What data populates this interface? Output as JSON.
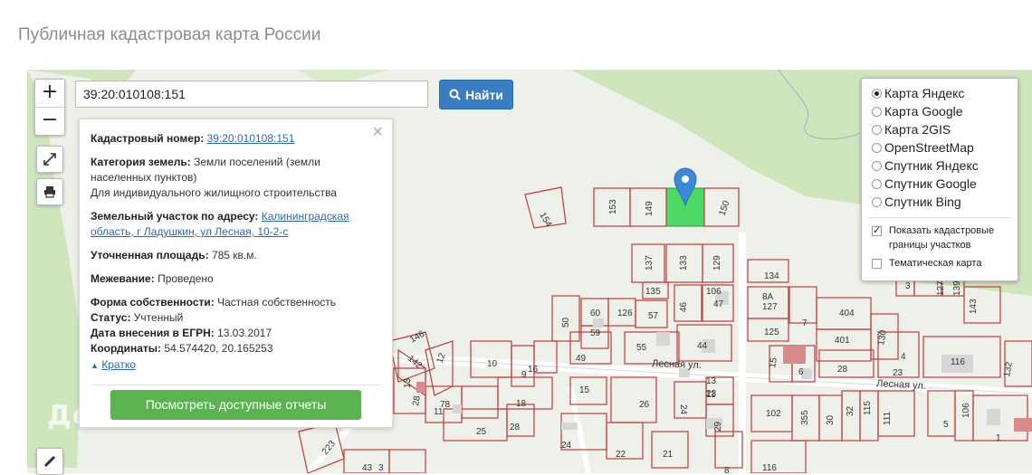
{
  "page": {
    "title": "Публичная кадастровая карта России"
  },
  "search": {
    "value": "39:20:010108:151",
    "button_label": "Найти"
  },
  "zoom": {
    "plus": "+",
    "minus": "−"
  },
  "info": {
    "cadastral_label": "Кадастровый номер:",
    "cadastral_value": "39:20:010108:151",
    "category_label": "Категория земель:",
    "category_value": "Земли поселений (земли населенных пунктов)",
    "purpose": "Для индивидуального жилищного строительства",
    "address_label": "Земельный участок по адресу:",
    "address_value": "Калининградская область, г Ладушкин, ул Лесная, 10-2-с",
    "area_label": "Уточненная площадь:",
    "area_value": "785 кв.м.",
    "survey_label": "Межевание:",
    "survey_value": "Проведено",
    "ownership_label": "Форма собственности:",
    "ownership_value": "Частная собственность",
    "status_label": "Статус:",
    "status_value": "Учтенный",
    "date_label": "Дата внесения в ЕГРН:",
    "date_value": "13.03.2017",
    "coords_label": "Координаты:",
    "coords_value": "54.574420, 20.165253",
    "collapse_label": "Кратко",
    "reports_button": "Посмотреть доступные отчеты",
    "close_symbol": "×"
  },
  "layers": {
    "options": [
      {
        "label": "Карта Яндекс",
        "selected": true
      },
      {
        "label": "Карта Google",
        "selected": false
      },
      {
        "label": "Карта 2GIS",
        "selected": false
      },
      {
        "label": "OpenStreetMap",
        "selected": false
      },
      {
        "label": "Спутник Яндекс",
        "selected": false
      },
      {
        "label": "Спутник Google",
        "selected": false
      },
      {
        "label": "Спутник Bing",
        "selected": false
      }
    ],
    "show_borders": {
      "label": "Показать кадастровые границы участков",
      "checked": true
    },
    "thematic": {
      "label": "Тематическая карта",
      "checked": false
    }
  },
  "map": {
    "streets": [
      "Лесная ул.",
      "Лесная ул."
    ],
    "parcels": [
      "154",
      "153",
      "149",
      "150",
      "137",
      "133",
      "129",
      "134",
      "135",
      "106",
      "8А",
      "127",
      "46",
      "47",
      "50",
      "60",
      "126",
      "57",
      "7",
      "404",
      "59",
      "125",
      "146",
      "55",
      "44",
      "401",
      "130",
      "142",
      "12",
      "10",
      "9",
      "16",
      "49",
      "15",
      "6",
      "28",
      "4",
      "23",
      "116",
      "13",
      "132",
      "28",
      "78",
      "11",
      "18",
      "15",
      "13",
      "11",
      "26",
      "24",
      "23",
      "102",
      "355",
      "30",
      "32",
      "115",
      "111",
      "5",
      "106",
      "1",
      "25",
      "28",
      "24",
      "22",
      "21",
      "29",
      "116",
      "223",
      "43",
      "3",
      "8",
      "127",
      "139",
      "143",
      "3"
    ],
    "watermark": "ДомКлик",
    "colors": {
      "selected_parcel": "#4cd964",
      "marker": "#3a8ad8",
      "parcel_border": "#c0393b",
      "forest": "#cfe6bd"
    }
  }
}
